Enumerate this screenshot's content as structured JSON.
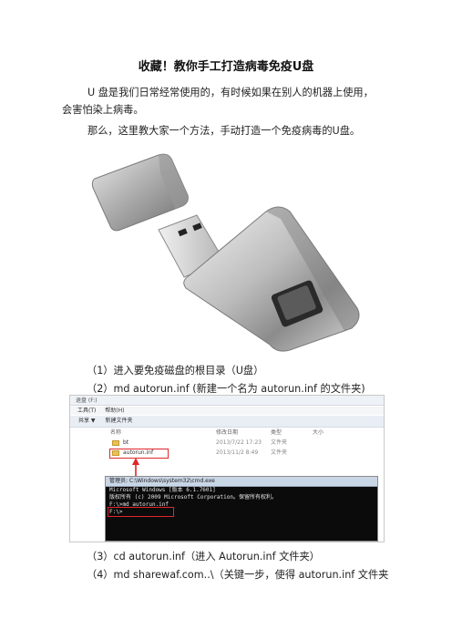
{
  "title": "收藏！教你手工打造病毒免疫U盘",
  "intro_line1": "U 盘是我们日常经常使用的，有时候如果在别人的机器上使用，",
  "intro_line2": "会害怕染上病毒。",
  "intro_line3": "那么，这里教大家一个方法，手动打造一个免疫病毒的U盘。",
  "steps": [
    "（1）进入要免疫磁盘的根目录（U盘）",
    "（2）md autorun.inf (新建一个名为 autorun.inf 的文件夹)",
    "（3）cd autorun.inf（进入 Autorun.inf 文件夹）",
    "（4）md  sharewaf.com..\\（关键一步，使得 autorun.inf 文件夹"
  ],
  "screenshot": {
    "address_bar": "退盘 (F:)",
    "menu": [
      "工具(T)",
      "帮助(H)"
    ],
    "toolbar": [
      "共享 ▼",
      "新建文件夹"
    ],
    "columns": [
      "名称",
      "修改日期",
      "类型",
      "大小"
    ],
    "files": [
      {
        "name": "bt",
        "date": "2013/7/22 17:23",
        "type": "文件夹"
      },
      {
        "name": "autorun.inf",
        "date": "2013/11/2 8:49",
        "type": "文件夹"
      }
    ],
    "cmd_title": "管理员: C:\\Windows\\system32\\cmd.exe",
    "cmd_lines": [
      "Microsoft Windows [版本 6.1.7601]",
      "版权所有 (c) 2009 Microsoft Corporation。保留所有权利。",
      "",
      "F:\\>md autorun.inf",
      "",
      "F:\\>"
    ]
  }
}
